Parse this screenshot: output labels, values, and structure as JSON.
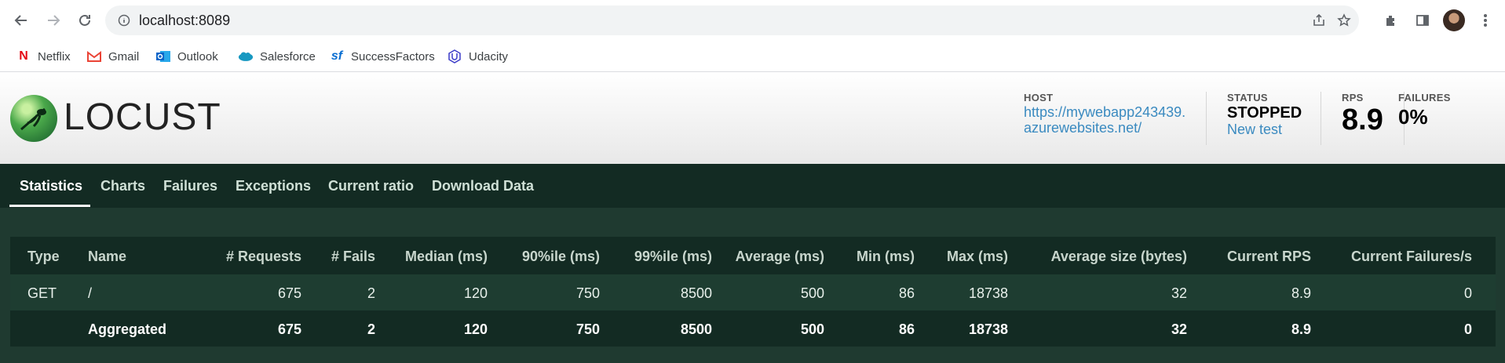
{
  "browser": {
    "address": "localhost:8089",
    "bookmarks": [
      {
        "label": "Netflix",
        "icon": "netflix-icon",
        "color": "#e50914"
      },
      {
        "label": "Gmail",
        "icon": "gmail-icon",
        "color": "#ea4335"
      },
      {
        "label": "Outlook",
        "icon": "outlook-icon",
        "color": "#0a64c8"
      },
      {
        "label": "Salesforce",
        "icon": "salesforce-icon",
        "color": "#1798c1"
      },
      {
        "label": "SuccessFactors",
        "icon": "successfactors-icon",
        "color": "#0a6ed1"
      },
      {
        "label": "Udacity",
        "icon": "udacity-icon",
        "color": "#3b3bc8"
      }
    ]
  },
  "header": {
    "logo_text": "LOCUST",
    "host_label": "HOST",
    "host_line1": "https://mywebapp243439.",
    "host_line2": "azurewebsites.net/",
    "status_label": "STATUS",
    "status_value": "STOPPED",
    "new_test": "New test",
    "rps_label": "RPS",
    "rps_value": "8.9",
    "failures_label": "FAILURES",
    "failures_value": "0%"
  },
  "tabs": [
    "Statistics",
    "Charts",
    "Failures",
    "Exceptions",
    "Current ratio",
    "Download Data"
  ],
  "table": {
    "headers": [
      "Type",
      "Name",
      "# Requests",
      "# Fails",
      "Median (ms)",
      "90%ile (ms)",
      "99%ile (ms)",
      "Average (ms)",
      "Min (ms)",
      "Max (ms)",
      "Average size (bytes)",
      "Current RPS",
      "Current Failures/s"
    ],
    "rows": [
      [
        "GET",
        "/",
        "675",
        "2",
        "120",
        "750",
        "8500",
        "500",
        "86",
        "18738",
        "32",
        "8.9",
        "0"
      ],
      [
        "",
        "Aggregated",
        "675",
        "2",
        "120",
        "750",
        "8500",
        "500",
        "86",
        "18738",
        "32",
        "8.9",
        "0"
      ]
    ]
  },
  "colors": {
    "nav_bg": "#132b23",
    "content_bg": "#1f3a30",
    "link": "#3a8ac0"
  }
}
